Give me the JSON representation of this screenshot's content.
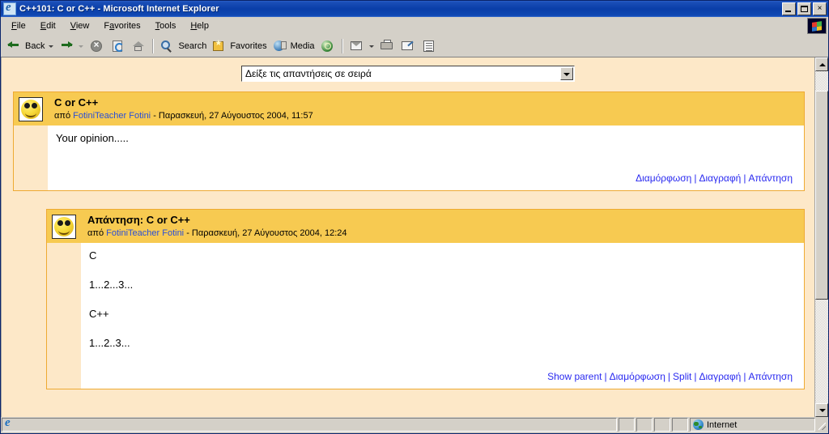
{
  "window": {
    "title": "C++101: C or C++ - Microsoft Internet Explorer",
    "icon": "ie-document-icon",
    "minimize_label": "",
    "maximize_label": "",
    "close_label": "×"
  },
  "menubar": {
    "items": [
      {
        "label": "File",
        "accel": "F"
      },
      {
        "label": "Edit",
        "accel": "E"
      },
      {
        "label": "View",
        "accel": "V"
      },
      {
        "label": "Favorites",
        "accel": "a"
      },
      {
        "label": "Tools",
        "accel": "T"
      },
      {
        "label": "Help",
        "accel": "H"
      }
    ],
    "logo_button": "windows-flag-icon"
  },
  "toolbar": {
    "back_label": "Back",
    "back_icon": "arrow-left-icon",
    "forward_icon": "arrow-right-icon",
    "stop_icon": "stop-icon",
    "refresh_icon": "refresh-icon",
    "home_icon": "home-icon",
    "search_label": "Search",
    "search_icon": "search-icon",
    "favorites_label": "Favorites",
    "favorites_icon": "favorites-star-icon",
    "media_label": "Media",
    "media_icon": "media-icon",
    "history_icon": "history-globe-icon",
    "mail_icon": "mail-icon",
    "print_icon": "print-icon",
    "edit_icon": "edit-page-icon",
    "discuss_icon": "discuss-icon"
  },
  "page": {
    "display_mode_select": {
      "value": "Δείξε τις απαντήσεις σε σειρά",
      "arrow_icon": "chevron-down-icon"
    },
    "posts": [
      {
        "avatar": "smiley-face-avatar",
        "subject": "C or C++",
        "by_prefix": "από",
        "author": "FotiniTeacher Fotini",
        "datetime": "- Παρασκευή, 27 Αύγουστος 2004, 11:57",
        "body": [
          "Your opinion....."
        ],
        "links": [
          "Διαμόρφωση",
          "Διαγραφή",
          "Απάντηση"
        ]
      },
      {
        "avatar": "smiley-face-avatar",
        "subject": "Απάντηση: C or C++",
        "by_prefix": "από",
        "author": "FotiniTeacher Fotini",
        "datetime": "- Παρασκευή, 27 Αύγουστος 2004, 12:24",
        "body": [
          "C",
          "1...2...3...",
          "C++",
          "1...2..3..."
        ],
        "links": [
          "Show parent",
          "Διαμόρφωση",
          "Split",
          "Διαγραφή",
          "Απάντηση"
        ]
      }
    ]
  },
  "statusbar": {
    "message": "",
    "zone_label": "Internet",
    "zone_icon": "globe-icon",
    "page_icon": "ie-page-icon"
  },
  "colors": {
    "titlebar": "#0a3ea8",
    "chrome": "#d4d0c8",
    "page_background": "#fde8c8",
    "post_header": "#f7ca51",
    "post_border": "#eeaa33",
    "link": "#2a2af0",
    "author_link": "#2a4fd6"
  }
}
